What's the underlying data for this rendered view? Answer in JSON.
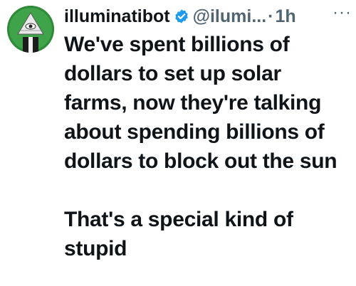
{
  "post": {
    "author": {
      "display_name": "illuminatibot",
      "handle": "@ilumi...",
      "verified": true
    },
    "separator": "·",
    "timestamp": "1h",
    "more_menu": "···",
    "text_paragraphs": [
      "We've spent billions of dollars to set up solar farms, now they're talking about spending billions of dollars to block out the sun",
      "That's a special kind of stupid"
    ]
  },
  "colors": {
    "text_primary": "#0f1419",
    "text_secondary": "#536471",
    "verified_blue": "#1d9bf0",
    "avatar_green": "#2f8a3a"
  }
}
